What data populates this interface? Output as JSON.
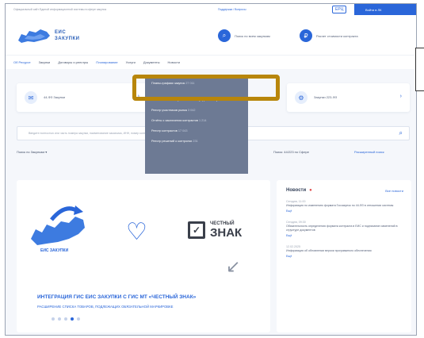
{
  "topbar": {
    "gov_text": "Официальный сайт Единой информационной системы в сфере закупок",
    "help_text": "Поддержка / Вопросы",
    "lang": "ЕРЦ",
    "login": "Войти в ЛК"
  },
  "header": {
    "logo_line1": "ЕИС",
    "logo_line2": "ЗАКУПКИ",
    "button1": "Поиск по всем закупкам",
    "button2": "Расчет стоимости контракта"
  },
  "nav": {
    "items": [
      "Об Ресурсе",
      "Закупки",
      "Договоры и реестры",
      "Планирование",
      "Услуги",
      "Документы",
      "Новости"
    ]
  },
  "cards": {
    "card1_label": "44-ФЗ Закупки",
    "card3_label": "Закупки 223-ФЗ"
  },
  "search": {
    "placeholder": "Введите полностью или часть номера закупки, наименование заказчика, ИНН, номер контракта или иное..."
  },
  "filters": {
    "f1": "Поиск по  Закупкам ▾",
    "f2": "Поиск: 44/223 по Сфере",
    "f3": "Расширенный поиск"
  },
  "banner": {
    "logo_caption": "ЕИС ЗАКУПКИ",
    "cz_small": "ЧЕСТНЫЙ",
    "cz_big": "ЗНАК",
    "title": "ИНТЕГРАЦИЯ ГИС ЕИС ЗАКУПКИ С ГИС МТ «ЧЕСТНЫЙ ЗНАК»",
    "subtitle": "РАСШИРЕНИЕ СПИСКА ТОВАРОВ, ПОДЛЕЖАЩИХ ОБЯЗАТЕЛЬНОЙ МАРКИРОВКЕ"
  },
  "news": {
    "heading": "Новости",
    "all_link": "Все новости",
    "items": [
      {
        "date": "Сегодня, 11:00",
        "text": "Информация по изменению формата Госзакупок по 44-ФЗ в отношении системы",
        "more": "Ещё"
      },
      {
        "date": "Сегодня, 09:30",
        "text": "Обязательность определения формата контракта в ЕИС и подписание изменений в структуре документов",
        "more": "Ещё"
      },
      {
        "date": "12.02.2025",
        "text": "Информация об обновлении версии программного обеспечения",
        "more": "Ещё"
      }
    ]
  },
  "dropdown": {
    "items": [
      {
        "label": "Планы-графики закупок",
        "count": "27 011"
      },
      {
        "label": "",
        "count": ""
      },
      {
        "label": "Обязательные общественные обсуждения закупок",
        "count": "12"
      },
      {
        "label": "Реестр участников рынка",
        "count": "3 042"
      },
      {
        "label": "Отчёты о заключении контрактов",
        "count": "1 214"
      },
      {
        "label": "Реестр контрактов",
        "count": "17 043"
      },
      {
        "label": "Реестр решений о контролях",
        "count": "231"
      }
    ]
  }
}
